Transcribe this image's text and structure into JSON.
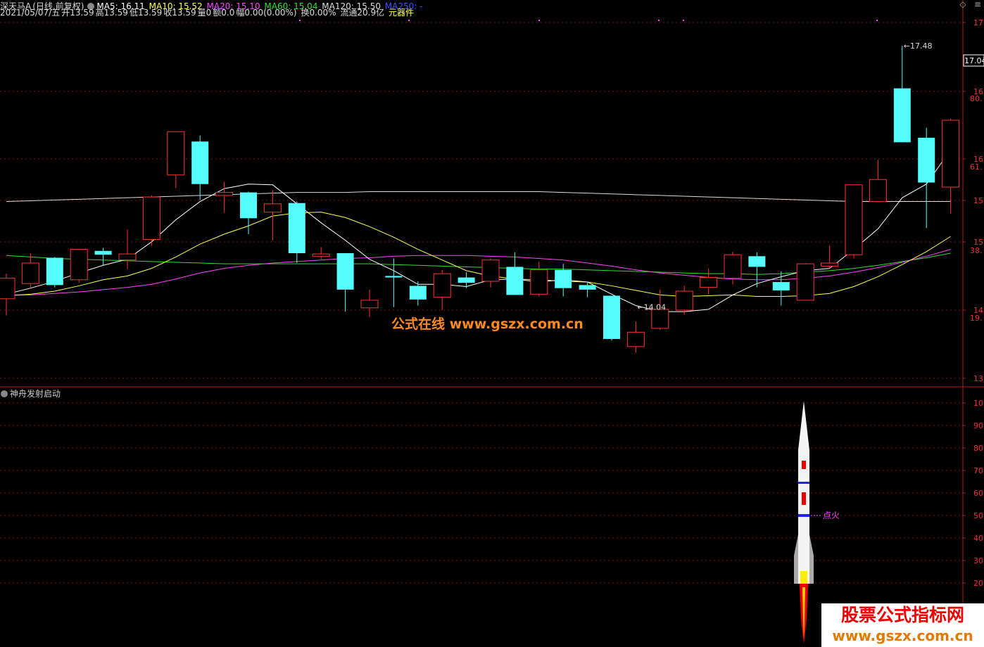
{
  "header": {
    "stock": "深天马A",
    "mode": "(日线,前复权)",
    "ma5": "MA5: 16.11",
    "ma10": "MA10: 15.52",
    "ma20": "MA20: 15.10",
    "ma60": "MA60: 15.04",
    "ma120": "MA120: 15.50",
    "ma250": "MA250: -",
    "date": "2021/05/07/五",
    "open": "开13.59",
    "high": "高13.59",
    "low": "低13.59",
    "close": "收13.59",
    "vol": "量0",
    "amt": "额0.0",
    "chg": "幅0.00(0.00%)",
    "turn": "换0.00%",
    "float": "流通20.9亿",
    "sector": "元器件"
  },
  "indicator": {
    "title": "神舟发射启动",
    "ignite_label": "点火"
  },
  "watermarks": {
    "center": "公式在线  www.gszx.com.cn",
    "corner_line1": "股票公式指标网",
    "corner_line2": "www.gszx.com.cn"
  },
  "top_icons": {
    "diamond": "◇",
    "menu": "≡"
  },
  "colors": {
    "up": "#ff3232",
    "down": "#54fcfc",
    "ma5": "#ffffff",
    "ma10": "#ffff55",
    "ma20": "#ff44ff",
    "ma60": "#33dd33",
    "ma120": "#dddddd",
    "grid": "#7a1010"
  },
  "chart_data": {
    "type": "candlestick",
    "price_axis": {
      "min": 13,
      "max": 17,
      "ticks": [
        "17",
        "16",
        "16",
        "15",
        "15",
        "14",
        "13"
      ],
      "current": "17.04"
    },
    "extra_axis_labels": [
      "80.",
      "61.",
      "38.",
      "19."
    ],
    "annotations": [
      {
        "text": "17.48",
        "value": 17.48
      },
      {
        "text": "14.04",
        "value": 14.04
      }
    ],
    "candles": [
      {
        "o": 14.15,
        "h": 14.48,
        "l": 13.93,
        "c": 14.42
      },
      {
        "o": 14.35,
        "h": 14.75,
        "l": 14.3,
        "c": 14.62
      },
      {
        "o": 14.69,
        "h": 14.7,
        "l": 14.3,
        "c": 14.33
      },
      {
        "o": 14.4,
        "h": 14.79,
        "l": 14.36,
        "c": 14.8
      },
      {
        "o": 14.78,
        "h": 14.82,
        "l": 14.59,
        "c": 14.73
      },
      {
        "o": 14.66,
        "h": 15.06,
        "l": 14.54,
        "c": 14.74
      },
      {
        "o": 14.93,
        "h": 15.51,
        "l": 14.85,
        "c": 15.49
      },
      {
        "o": 15.78,
        "h": 16.09,
        "l": 15.61,
        "c": 16.35
      },
      {
        "o": 16.22,
        "h": 16.3,
        "l": 15.45,
        "c": 15.66
      },
      {
        "o": 15.51,
        "h": 15.69,
        "l": 15.28,
        "c": 15.55
      },
      {
        "o": 15.55,
        "h": 15.56,
        "l": 15.0,
        "c": 15.21
      },
      {
        "o": 15.29,
        "h": 15.58,
        "l": 14.92,
        "c": 15.4
      },
      {
        "o": 15.41,
        "h": 15.43,
        "l": 14.62,
        "c": 14.75
      },
      {
        "o": 14.71,
        "h": 14.83,
        "l": 14.67,
        "c": 14.74
      },
      {
        "o": 14.75,
        "h": 14.75,
        "l": 13.98,
        "c": 14.27
      },
      {
        "o": 14.03,
        "h": 14.27,
        "l": 13.91,
        "c": 14.13
      },
      {
        "o": 14.45,
        "h": 14.68,
        "l": 14.04,
        "c": 14.43
      },
      {
        "o": 14.32,
        "h": 14.38,
        "l": 14.06,
        "c": 14.14
      },
      {
        "o": 14.17,
        "h": 14.53,
        "l": 14.0,
        "c": 14.48
      },
      {
        "o": 14.43,
        "h": 14.5,
        "l": 14.29,
        "c": 14.36
      },
      {
        "o": 14.38,
        "h": 14.68,
        "l": 14.3,
        "c": 14.66
      },
      {
        "o": 14.57,
        "h": 14.76,
        "l": 14.22,
        "c": 14.2
      },
      {
        "o": 14.21,
        "h": 14.64,
        "l": 14.18,
        "c": 14.53
      },
      {
        "o": 14.53,
        "h": 14.61,
        "l": 14.18,
        "c": 14.29
      },
      {
        "o": 14.33,
        "h": 14.37,
        "l": 14.17,
        "c": 14.27
      },
      {
        "o": 14.19,
        "h": 14.19,
        "l": 13.6,
        "c": 13.62
      },
      {
        "o": 13.52,
        "h": 13.85,
        "l": 13.44,
        "c": 13.71
      },
      {
        "o": 13.76,
        "h": 14.27,
        "l": 13.74,
        "c": 14.01
      },
      {
        "o": 14.0,
        "h": 14.32,
        "l": 13.94,
        "c": 14.25
      },
      {
        "o": 14.3,
        "h": 14.55,
        "l": 14.21,
        "c": 14.43
      },
      {
        "o": 14.42,
        "h": 14.77,
        "l": 14.34,
        "c": 14.73
      },
      {
        "o": 14.71,
        "h": 14.76,
        "l": 14.3,
        "c": 14.57
      },
      {
        "o": 14.37,
        "h": 14.51,
        "l": 14.06,
        "c": 14.26
      },
      {
        "o": 14.13,
        "h": 14.62,
        "l": 14.14,
        "c": 14.61
      },
      {
        "o": 14.58,
        "h": 14.85,
        "l": 14.55,
        "c": 14.62
      },
      {
        "o": 14.73,
        "h": 15.61,
        "l": 14.68,
        "c": 15.65
      },
      {
        "o": 15.43,
        "h": 15.98,
        "l": 15.44,
        "c": 15.72
      },
      {
        "o": 16.92,
        "h": 17.48,
        "l": 16.63,
        "c": 16.21
      },
      {
        "o": 16.27,
        "h": 16.4,
        "l": 15.08,
        "c": 15.68
      },
      {
        "o": 15.62,
        "h": 16.52,
        "l": 15.27,
        "c": 16.5
      }
    ],
    "ma5": [
      14.21,
      14.29,
      14.38,
      14.49,
      14.59,
      14.67,
      14.9,
      15.19,
      15.43,
      15.6,
      15.66,
      15.65,
      15.4,
      15.15,
      14.92,
      14.67,
      14.52,
      14.34,
      14.34,
      14.31,
      14.4,
      14.41,
      14.37,
      14.4,
      14.37,
      14.21,
      14.06,
      13.98,
      13.98,
      14.01,
      14.2,
      14.35,
      14.44,
      14.52,
      14.55,
      14.8,
      15.07,
      15.48,
      15.66,
      16.11
    ],
    "ma10": [
      14.19,
      14.21,
      14.25,
      14.32,
      14.4,
      14.45,
      14.55,
      14.7,
      14.87,
      15.0,
      15.11,
      15.24,
      15.28,
      15.29,
      15.22,
      15.1,
      14.96,
      14.8,
      14.66,
      14.52,
      14.45,
      14.41,
      14.4,
      14.38,
      14.37,
      14.32,
      14.26,
      14.2,
      14.18,
      14.19,
      14.2,
      14.18,
      14.18,
      14.19,
      14.22,
      14.31,
      14.44,
      14.6,
      14.77,
      14.97
    ],
    "ma20": [
      14.2,
      14.2,
      14.22,
      14.24,
      14.27,
      14.3,
      14.34,
      14.41,
      14.49,
      14.55,
      14.59,
      14.62,
      14.64,
      14.66,
      14.68,
      14.69,
      14.71,
      14.72,
      14.72,
      14.72,
      14.71,
      14.7,
      14.68,
      14.66,
      14.62,
      14.58,
      14.53,
      14.49,
      14.46,
      14.43,
      14.41,
      14.4,
      14.4,
      14.42,
      14.45,
      14.5,
      14.56,
      14.63,
      14.71,
      14.8
    ],
    "ma60": [
      14.72,
      14.7,
      14.68,
      14.67,
      14.66,
      14.65,
      14.64,
      14.63,
      14.62,
      14.61,
      14.61,
      14.61,
      14.61,
      14.61,
      14.61,
      14.61,
      14.6,
      14.59,
      14.58,
      14.57,
      14.56,
      14.55,
      14.54,
      14.54,
      14.53,
      14.52,
      14.51,
      14.5,
      14.49,
      14.48,
      14.48,
      14.47,
      14.48,
      14.5,
      14.52,
      14.55,
      14.59,
      14.64,
      14.69,
      14.75
    ],
    "ma120": [
      15.43,
      15.44,
      15.45,
      15.46,
      15.47,
      15.48,
      15.49,
      15.5,
      15.51,
      15.52,
      15.53,
      15.54,
      15.55,
      15.55,
      15.55,
      15.56,
      15.56,
      15.56,
      15.56,
      15.56,
      15.56,
      15.56,
      15.56,
      15.55,
      15.54,
      15.53,
      15.52,
      15.51,
      15.5,
      15.49,
      15.48,
      15.47,
      15.46,
      15.45,
      15.44,
      15.43,
      15.43,
      15.43,
      15.43,
      15.43
    ],
    "sub_axis": {
      "ticks": [
        "10",
        "90",
        "80",
        "70",
        "60",
        "50",
        "40",
        "30",
        "20"
      ]
    }
  }
}
